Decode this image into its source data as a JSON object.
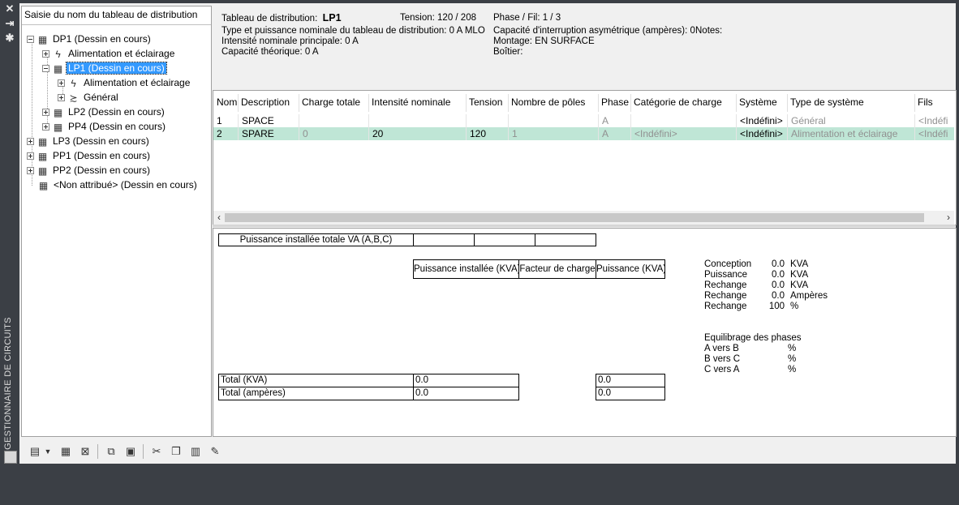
{
  "palette": {
    "title": "GESTIONNAIRE DE CIRCUITS",
    "buttons": [
      "close-icon",
      "auto-hide-icon",
      "properties-icon"
    ]
  },
  "tree": {
    "header": "Saisie du nom du tableau de distribution",
    "nodes": [
      {
        "label": "DP1 (Dessin en cours)",
        "icon": "panel-icon"
      },
      {
        "label": "Alimentation et éclairage",
        "icon": "power-lighting-icon"
      },
      {
        "label": "LP1 (Dessin en cours)",
        "icon": "panel-icon"
      },
      {
        "label": "Alimentation et éclairage",
        "icon": "power-lighting-icon"
      },
      {
        "label": "Général",
        "icon": "general-system-icon"
      },
      {
        "label": "LP2 (Dessin en cours)",
        "icon": "panel-icon"
      },
      {
        "label": "PP4 (Dessin en cours)",
        "icon": "panel-icon"
      },
      {
        "label": "LP3 (Dessin en cours)",
        "icon": "panel-icon"
      },
      {
        "label": "PP1 (Dessin en cours)",
        "icon": "panel-icon"
      },
      {
        "label": "PP2 (Dessin en cours)",
        "icon": "panel-icon"
      },
      {
        "label": "<Non attribué> (Dessin en cours)",
        "icon": "panel-icon"
      }
    ]
  },
  "info": {
    "panel_label": "Tableau de distribution:",
    "panel_value": "LP1",
    "tension": "Tension:   120 / 208",
    "phase": "Phase / Fil:  1 /  3",
    "type_power": "Type et puissance nominale du tableau de distribution: 0 A MLO",
    "interrupt": "Capacité d'interruption asymétrique (ampères):   0",
    "notes": "Notes:",
    "main_current": "Intensité nominale principale: 0 A",
    "mounting": "Montage:    EN SURFACE",
    "theoretical": "Capacité théorique: 0 A",
    "enclosure": "Boîtier:"
  },
  "grid": {
    "columns": [
      "Nom",
      "Description",
      "Charge totale",
      "Intensité nominale",
      "Tension",
      "Nombre de pôles",
      "Phase",
      "Catégorie de charge",
      "Système",
      "Type de système",
      "Fils"
    ],
    "rows": [
      {
        "cells": [
          "1",
          "SPACE",
          "",
          "",
          "",
          "",
          "A",
          "",
          "<Indéfini>",
          "Général",
          "<Indéfi"
        ]
      },
      {
        "cells": [
          "2",
          "SPARE",
          "0",
          "20",
          "120",
          "1",
          "A",
          "<Indéfini>",
          "<Indéfini>",
          "Alimentation et éclairage",
          "<Indéfi"
        ]
      }
    ],
    "scroll_left": "‹",
    "scroll_right": "›"
  },
  "summary": {
    "total_va_label": "Puissance installée totale VA (A,B,C)",
    "headers": [
      "Puissance installée (KVA)",
      "Facteur de charge",
      "Puissance (KVA)"
    ],
    "total_kva_label": "Total (KVA)",
    "total_kva_installed": "0.0",
    "total_kva_power": "0.0",
    "total_amps_label": "Total (ampères)",
    "total_amps_installed": "0.0",
    "total_amps_power": "0.0",
    "stats": [
      {
        "label": "Conception",
        "value": "0.0",
        "unit": "KVA"
      },
      {
        "label": "Puissance",
        "value": "0.0",
        "unit": "KVA"
      },
      {
        "label": "Rechange",
        "value": "0.0",
        "unit": "KVA"
      },
      {
        "label": "Rechange",
        "value": "0.0",
        "unit": "Ampères"
      },
      {
        "label": "Rechange",
        "value": "100",
        "unit": "%"
      }
    ],
    "balance_title": "Equilibrage des phases",
    "balance": [
      {
        "label": "A vers B",
        "unit": "%"
      },
      {
        "label": "B vers C",
        "unit": "%"
      },
      {
        "label": "C vers A",
        "unit": "%"
      }
    ]
  },
  "toolbar": {
    "buttons": [
      "new-panel-icon",
      "dropdown-arrow-icon",
      "new-system-icon",
      "delete-icon",
      "copy-panel-icon",
      "paste-panel-icon",
      "cut-icon",
      "copy-icon",
      "paste-icon",
      "edit-icon"
    ]
  }
}
